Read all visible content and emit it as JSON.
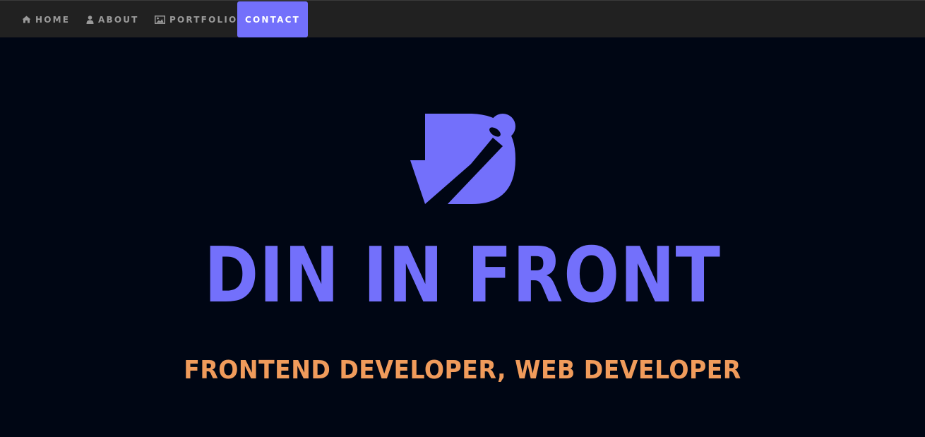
{
  "nav": {
    "items": [
      {
        "label": "HOME",
        "icon": "home-icon"
      },
      {
        "label": "ABOUT",
        "icon": "user-icon"
      },
      {
        "label": "PORTFOLIO",
        "icon": "image-icon"
      },
      {
        "label": "CONTACT",
        "icon": null,
        "active": true
      }
    ]
  },
  "hero": {
    "logo_icon": "din-logo",
    "title": "DIN IN FRONT",
    "subtitle": "FRONTEND DEVELOPER, WEB DEVELOPER"
  },
  "colors": {
    "background": "#000614",
    "navbar": "#212121",
    "accent": "#7370fb",
    "subtitle": "#f09b5b",
    "nav_text": "#9a9a9a"
  }
}
